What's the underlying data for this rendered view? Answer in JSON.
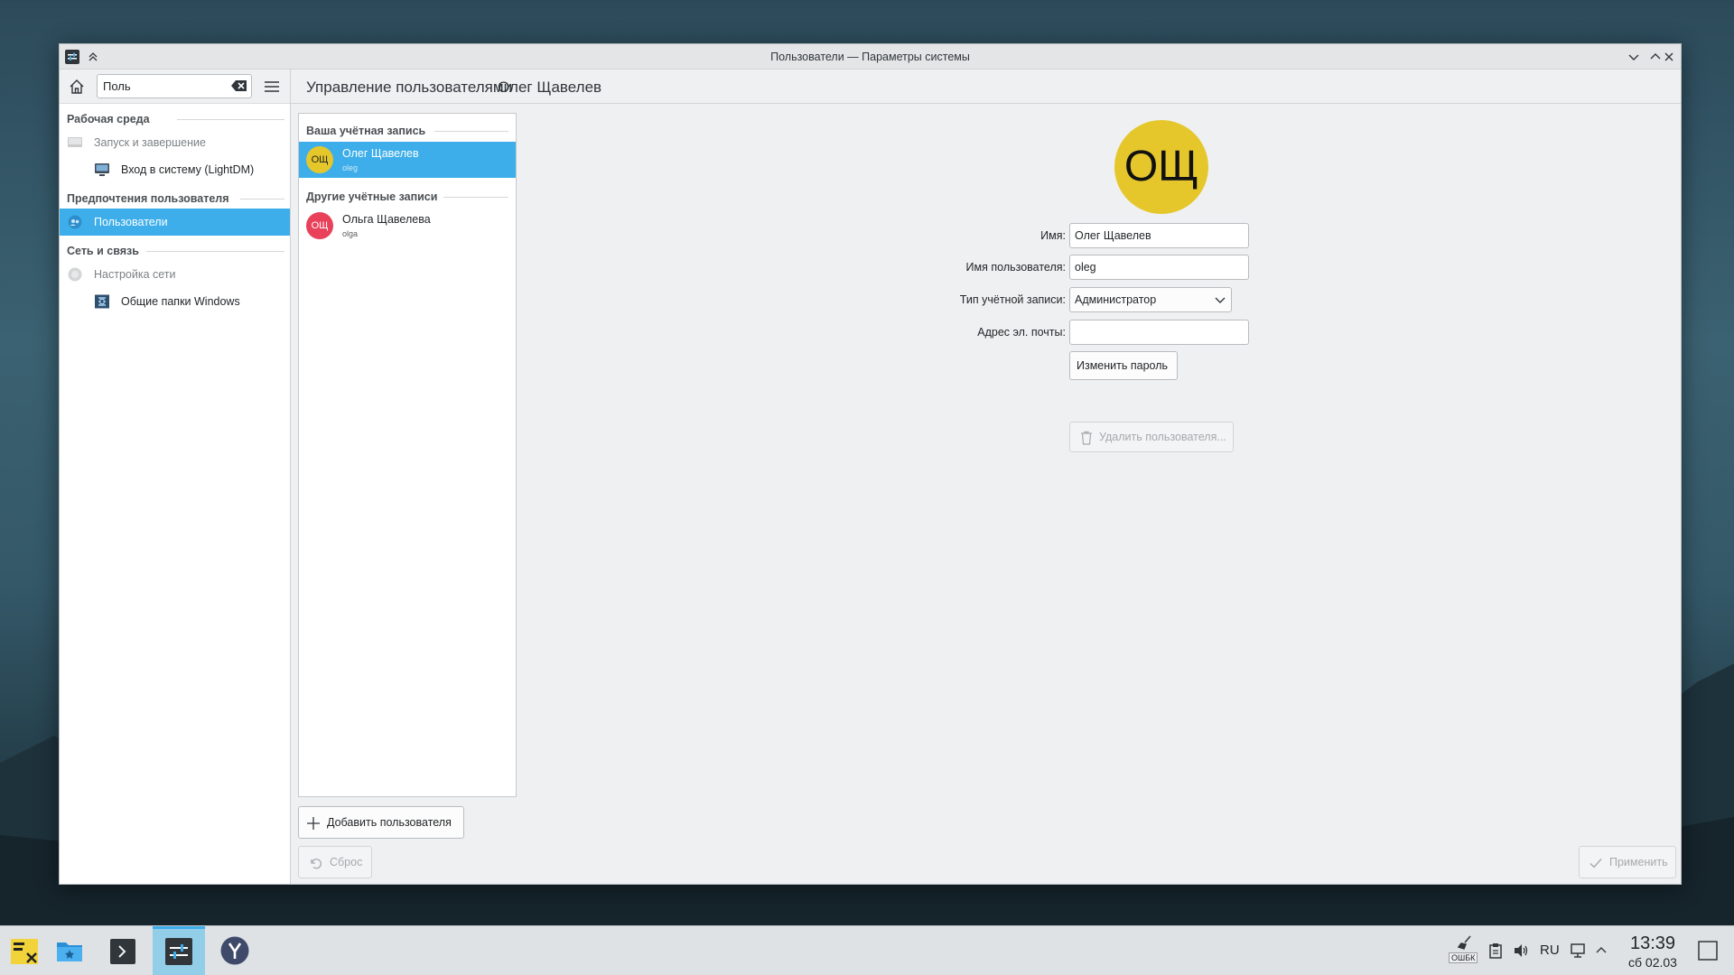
{
  "window": {
    "title": "Пользователи — Параметры системы"
  },
  "sidebar": {
    "search_value": "Поль",
    "categories": [
      {
        "label": "Рабочая среда",
        "items": [
          {
            "label": "Запуск и завершение",
            "muted": true
          },
          {
            "label": "Вход в систему (LightDM)"
          }
        ]
      },
      {
        "label": "Предпочтения пользователя",
        "items": [
          {
            "label": "Пользователи",
            "selected": true
          }
        ]
      },
      {
        "label": "Сеть и связь",
        "items": [
          {
            "label": "Настройка сети",
            "muted": true
          },
          {
            "label": "Общие папки Windows"
          }
        ]
      }
    ]
  },
  "breadcrumb": {
    "parent": "Управление пользователями",
    "current": "Олег Щавелев"
  },
  "users": {
    "own_header": "Ваша учётная запись",
    "other_header": "Другие учётные записи",
    "own": {
      "initials": "ОЩ",
      "name": "Олег Щавелев",
      "login": "oleg",
      "color": "#e5c72c"
    },
    "others": [
      {
        "initials": "ОЩ",
        "name": "Ольга Щавелева",
        "login": "olga",
        "color": "#e9415a"
      }
    ],
    "add_button": "Добавить пользователя",
    "reset_button": "Сброс"
  },
  "form": {
    "avatar_initials": "ОЩ",
    "name_label": "Имя:",
    "name_value": "Олег Щавелев",
    "username_label": "Имя пользователя:",
    "username_value": "oleg",
    "type_label": "Тип учётной записи:",
    "type_value": "Администратор",
    "email_label": "Адрес эл. почты:",
    "email_value": "",
    "change_password": "Изменить пароль",
    "delete_user": "Удалить пользователя...",
    "apply": "Применить"
  },
  "taskbar": {
    "keyboard_layout": "RU",
    "error_badge": "ОШБК",
    "time": "13:39",
    "date": "сб 02.03"
  },
  "colors": {
    "accent": "#3daee9",
    "window_bg": "#eff0f1"
  }
}
